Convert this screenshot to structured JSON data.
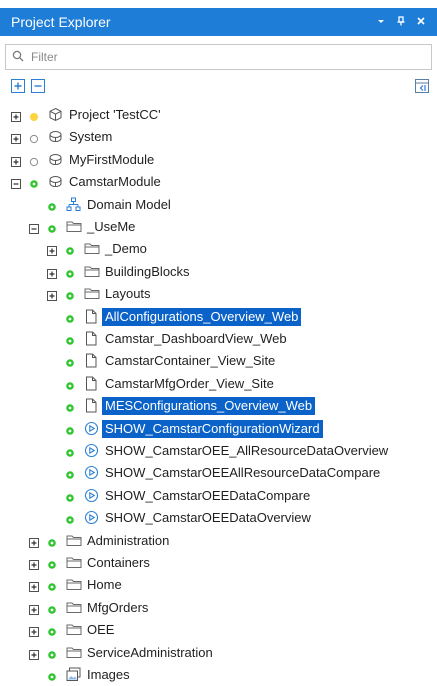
{
  "window": {
    "title": "Project Explorer",
    "controls": [
      "chevron-down-icon",
      "pin-icon",
      "close-icon"
    ]
  },
  "filter": {
    "placeholder": "Filter",
    "value": ""
  },
  "toolbar": {
    "left_buttons": [
      "expand-all-icon",
      "collapse-all-icon"
    ],
    "right_buttons": [
      "panel-layout-icon"
    ]
  },
  "colors": {
    "accent": "#1e7dd7",
    "selection": "#0b63c9",
    "status_active": "#2ec52e",
    "status_warning": "#ffd23f"
  },
  "tree": [
    {
      "label": "Project 'TestCC'",
      "level": 0,
      "expander": "plus",
      "status": "yellow",
      "icon": "project-cube-icon",
      "selected": false
    },
    {
      "label": "System",
      "level": 0,
      "expander": "plus",
      "status": "hollow",
      "icon": "module-icon",
      "selected": false
    },
    {
      "label": "MyFirstModule",
      "level": 0,
      "expander": "plus",
      "status": "hollow",
      "icon": "module-icon",
      "selected": false
    },
    {
      "label": "CamstarModule",
      "level": 0,
      "expander": "minus",
      "status": "green",
      "icon": "module-icon",
      "selected": false
    },
    {
      "label": "Domain Model",
      "level": 1,
      "expander": "none",
      "status": "green",
      "icon": "domain-model-icon",
      "selected": false
    },
    {
      "label": "_UseMe",
      "level": 1,
      "expander": "minus",
      "status": "green",
      "icon": "folder-icon",
      "selected": false
    },
    {
      "label": "_Demo",
      "level": 2,
      "expander": "plus",
      "status": "green",
      "icon": "folder-icon",
      "selected": false
    },
    {
      "label": "BuildingBlocks",
      "level": 2,
      "expander": "plus",
      "status": "green",
      "icon": "folder-icon",
      "selected": false
    },
    {
      "label": "Layouts",
      "level": 2,
      "expander": "plus",
      "status": "green",
      "icon": "folder-icon",
      "selected": false
    },
    {
      "label": "AllConfigurations_Overview_Web",
      "level": 2,
      "expander": "none",
      "status": "green",
      "icon": "page-icon",
      "selected": true
    },
    {
      "label": "Camstar_DashboardView_Web",
      "level": 2,
      "expander": "none",
      "status": "green",
      "icon": "page-icon",
      "selected": false
    },
    {
      "label": "CamstarContainer_View_Site",
      "level": 2,
      "expander": "none",
      "status": "green",
      "icon": "page-icon",
      "selected": false
    },
    {
      "label": "CamstarMfgOrder_View_Site",
      "level": 2,
      "expander": "none",
      "status": "green",
      "icon": "page-icon",
      "selected": false
    },
    {
      "label": "MESConfigurations_Overview_Web",
      "level": 2,
      "expander": "none",
      "status": "green",
      "icon": "page-icon",
      "selected": true
    },
    {
      "label": "SHOW_CamstarConfigurationWizard",
      "level": 2,
      "expander": "none",
      "status": "green",
      "icon": "microflow-icon",
      "selected": true
    },
    {
      "label": "SHOW_CamstarOEE_AllResourceDataOverview",
      "level": 2,
      "expander": "none",
      "status": "green",
      "icon": "microflow-icon",
      "selected": false
    },
    {
      "label": "SHOW_CamstarOEEAllResourceDataCompare",
      "level": 2,
      "expander": "none",
      "status": "green",
      "icon": "microflow-icon",
      "selected": false
    },
    {
      "label": "SHOW_CamstarOEEDataCompare",
      "level": 2,
      "expander": "none",
      "status": "green",
      "icon": "microflow-icon",
      "selected": false
    },
    {
      "label": "SHOW_CamstarOEEDataOverview",
      "level": 2,
      "expander": "none",
      "status": "green",
      "icon": "microflow-icon",
      "selected": false
    },
    {
      "label": "Administration",
      "level": 1,
      "expander": "plus",
      "status": "green",
      "icon": "folder-icon",
      "selected": false
    },
    {
      "label": "Containers",
      "level": 1,
      "expander": "plus",
      "status": "green",
      "icon": "folder-icon",
      "selected": false
    },
    {
      "label": "Home",
      "level": 1,
      "expander": "plus",
      "status": "green",
      "icon": "folder-icon",
      "selected": false
    },
    {
      "label": "MfgOrders",
      "level": 1,
      "expander": "plus",
      "status": "green",
      "icon": "folder-icon",
      "selected": false
    },
    {
      "label": "OEE",
      "level": 1,
      "expander": "plus",
      "status": "green",
      "icon": "folder-icon",
      "selected": false
    },
    {
      "label": "ServiceAdministration",
      "level": 1,
      "expander": "plus",
      "status": "green",
      "icon": "folder-icon",
      "selected": false
    },
    {
      "label": "Images",
      "level": 1,
      "expander": "none",
      "status": "green",
      "icon": "images-icon",
      "selected": false
    }
  ]
}
